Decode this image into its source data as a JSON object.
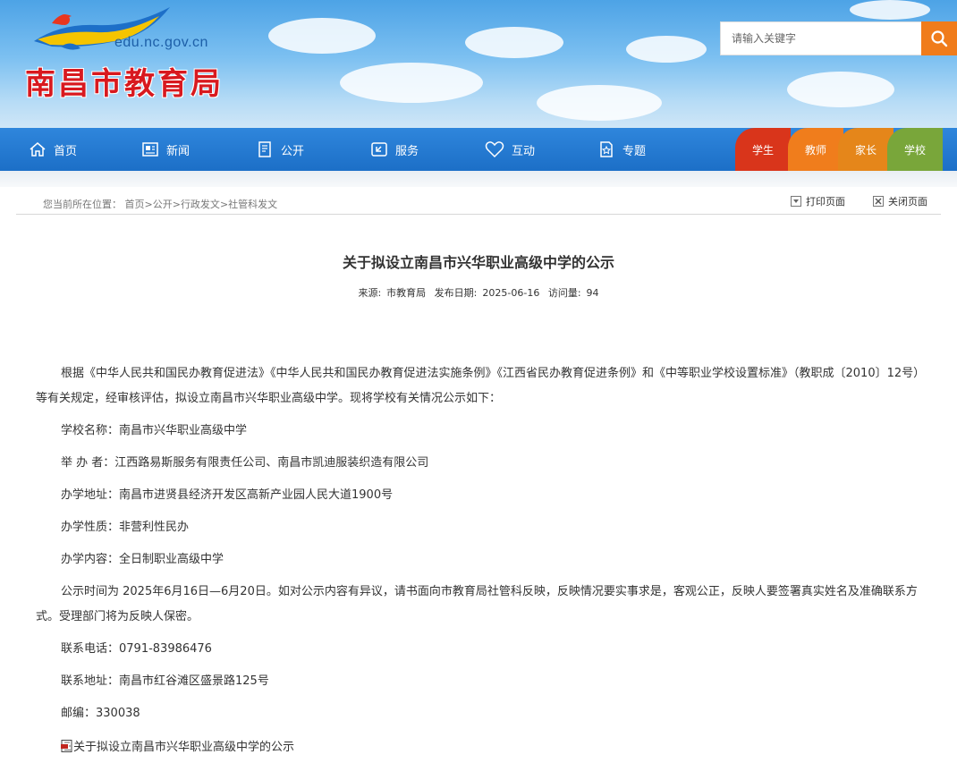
{
  "header": {
    "domain": "edu.nc.gov.cn",
    "site_name": "南昌市教育局",
    "search_placeholder": "请输入关键字",
    "search_icon": "search-icon"
  },
  "nav": {
    "items": [
      {
        "label": "首页",
        "icon": "home-icon"
      },
      {
        "label": "新闻",
        "icon": "news-icon"
      },
      {
        "label": "公开",
        "icon": "document-icon"
      },
      {
        "label": "服务",
        "icon": "service-icon"
      },
      {
        "label": "互动",
        "icon": "heart-icon"
      },
      {
        "label": "专题",
        "icon": "star-page-icon"
      }
    ],
    "roles": [
      {
        "label": "学生",
        "color": "#d9351b"
      },
      {
        "label": "教师",
        "color": "#f07d1c"
      },
      {
        "label": "家长",
        "color": "#e5861a"
      },
      {
        "label": "学校",
        "color": "#79a63a"
      }
    ]
  },
  "breadcrumb": {
    "prefix": "您当前所在位置：",
    "items": [
      "首页",
      "公开",
      "行政发文",
      "社管科发文"
    ],
    "separator": ">",
    "print_label": "打印页面",
    "close_label": "关闭页面"
  },
  "article": {
    "title": "关于拟设立南昌市兴华职业高级中学的公示",
    "source_label": "来源:",
    "source": "市教育局",
    "date_label": "发布日期:",
    "date": "2025-06-16",
    "views_label": "访问量:",
    "views": "94",
    "intro": "根据《中华人民共和国民办教育促进法》《中华人民共和国民办教育促进法实施条例》《江西省民办教育促进条例》和《中等职业学校设置标准》（教职成〔2010〕12号）等有关规定，经审核评估，拟设立南昌市兴华职业高级中学。现将学校有关情况公示如下：",
    "school_name": "学校名称：南昌市兴华职业高级中学",
    "sponsor": "举 办 者：江西路易斯服务有限责任公司、南昌市凯迪服装织造有限公司",
    "address": "办学地址：南昌市进贤县经济开发区高新产业园人民大道1900号",
    "nature": "办学性质：非营利性民办",
    "content": "办学内容：全日制职业高级中学",
    "period": "公示时间为 2025年6月16日—6月20日。如对公示内容有异议，请书面向市教育局社管科反映，反映情况要实事求是，客观公正，反映人要签署真实姓名及准确联系方式。受理部门将为反映人保密。",
    "phone": "联系电话：0791-83986476",
    "contact_address": "联系地址：南昌市红谷滩区盛景路125号",
    "postcode": "邮编：330038",
    "attachment": "关于拟设立南昌市兴华职业高级中学的公示"
  }
}
